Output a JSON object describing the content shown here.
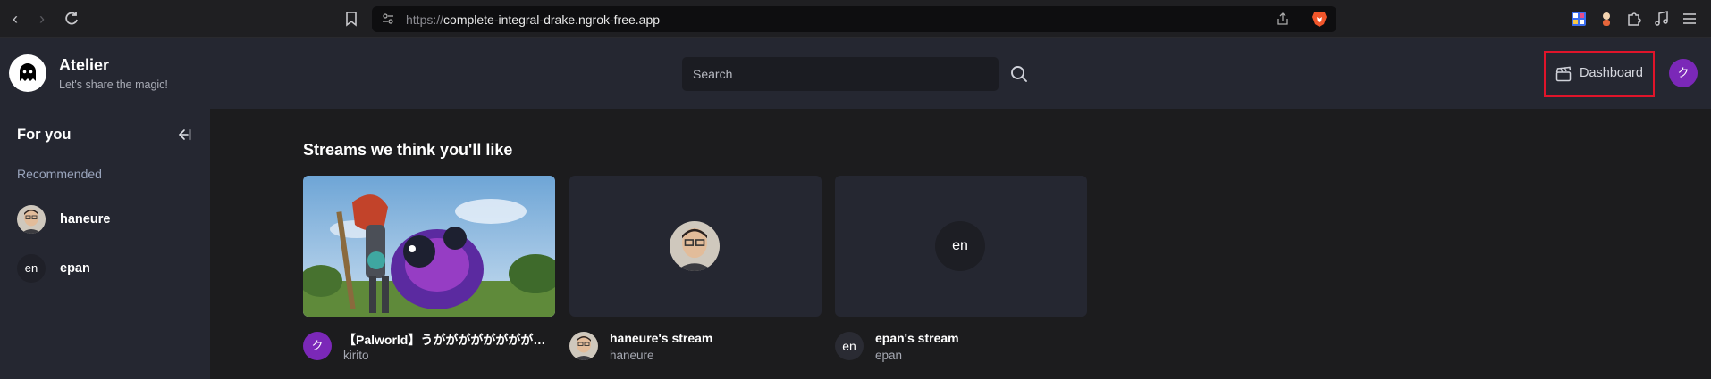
{
  "browser": {
    "url_protocol": "https://",
    "url_host": "complete-integral-drake.ngrok-free.app"
  },
  "header": {
    "app_name": "Atelier",
    "tagline": "Let's share the magic!",
    "search_placeholder": "Search",
    "dashboard_label": "Dashboard",
    "user_initial": "ク"
  },
  "sidebar": {
    "title": "For you",
    "section_label": "Recommended",
    "items": [
      {
        "label": "haneure",
        "avatar_type": "photo"
      },
      {
        "label": "epan",
        "avatar_initials": "en"
      }
    ]
  },
  "main": {
    "section_title": "Streams we think you'll like",
    "cards": [
      {
        "title": "【Palworld】うがががががががががが",
        "user": "kirito",
        "avatar_initial": "ク",
        "thumbnail": "game-scene"
      },
      {
        "title": "haneure's stream",
        "user": "haneure",
        "thumbnail": "avatar-photo"
      },
      {
        "title": "epan's stream",
        "user": "epan",
        "avatar_initials": "en",
        "thumbnail": "initials"
      }
    ]
  },
  "colors": {
    "accent_purple": "#7b28b8",
    "highlight_red": "#e0142a",
    "header_bg": "#252731",
    "main_bg": "#1c1c1e"
  }
}
